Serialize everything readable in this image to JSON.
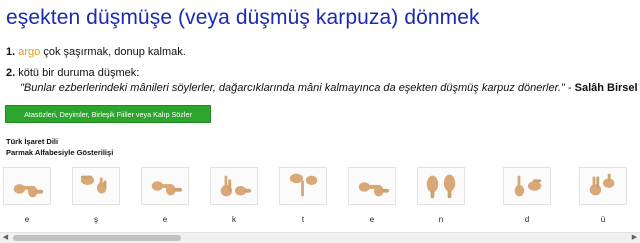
{
  "title": "eşekten düşmüşe (veya düşmüş karpuza) dönmek",
  "definitions": [
    {
      "number": "1.",
      "tag": "argo",
      "text": "çok şaşırmak, donup kalmak."
    },
    {
      "number": "2.",
      "text": "kötü bir duruma düşmek:",
      "quote": "\"Bunlar ezberlerindeki mânileri söylerler, dağarcıklarında mâni kalmayınca da eşekten düşmüş karpuz dönerler.\"",
      "quote_sep": " - ",
      "author": "Salâh Birsel"
    }
  ],
  "category_button": "Atasözleri, Deyimler, Birleşik Fiiller veya Kalıp Sözler",
  "sign_language": {
    "heading": "Türk İşaret Dili",
    "subheading": "Parmak Alfabesiyle Gösterilişi",
    "letters": [
      "e",
      "ş",
      "e",
      "k",
      "t",
      "e",
      "n",
      "d",
      "ü"
    ]
  },
  "colors": {
    "title": "#1a2bb3",
    "tag": "#e89a10",
    "button": "#2ca52c",
    "hand": "#d9a877"
  },
  "icons": {
    "scroll_left": "triangle-left-icon",
    "scroll_right": "triangle-right-icon"
  },
  "scroll": {
    "left_arrow": "◀",
    "right_arrow": "▶"
  }
}
